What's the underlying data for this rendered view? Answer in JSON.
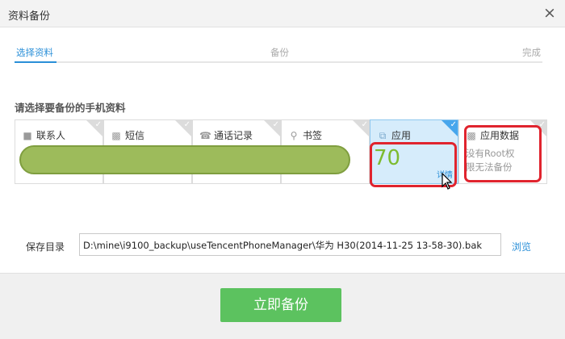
{
  "window": {
    "title": "资料备份",
    "close_label": "×"
  },
  "steps": [
    {
      "label": "选择资料",
      "active": true
    },
    {
      "label": "备份",
      "active": false
    },
    {
      "label": "完成",
      "active": false
    }
  ],
  "section_label": "请选择要备份的手机资料",
  "cards": [
    {
      "key": "contacts",
      "label": "联系人",
      "icon": "person-icon",
      "selected": false
    },
    {
      "key": "sms",
      "label": "短信",
      "icon": "message-icon",
      "selected": false
    },
    {
      "key": "calls",
      "label": "通话记录",
      "icon": "phone-icon",
      "selected": false
    },
    {
      "key": "bookmarks",
      "label": "书签",
      "icon": "bookmark-icon",
      "selected": false
    },
    {
      "key": "apps",
      "label": "应用",
      "icon": "apps-icon",
      "selected": true,
      "count": "70",
      "detail": "详情"
    },
    {
      "key": "appdata",
      "label": "应用数据",
      "icon": "bar-chart-icon",
      "selected": false,
      "note": "没有Root权限无法备份"
    }
  ],
  "save": {
    "label": "保存目录",
    "path": "D:\\mine\\i9100_backup\\useTencentPhoneManager\\华为 H30(2014-11-25 13-58-30).bak",
    "browse_label": "浏览"
  },
  "action": {
    "label": "立即备份",
    "color": "#5cc25f"
  },
  "colors": {
    "accent": "#2a8fd8",
    "selected_bg": "#d6ecfb",
    "count_green": "#7dbb2f",
    "annotation_red": "#e0242e"
  }
}
